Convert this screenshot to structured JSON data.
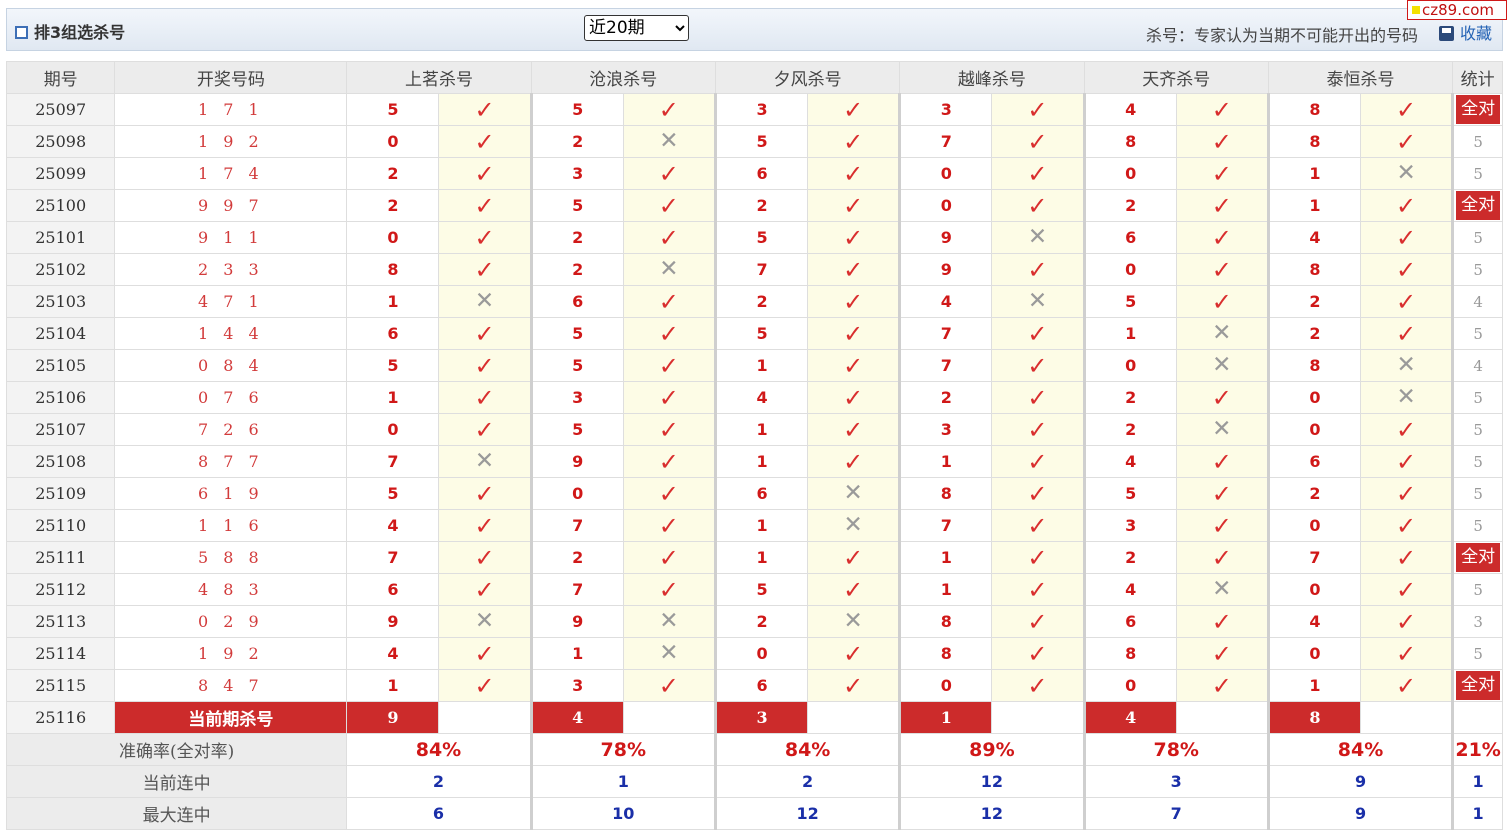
{
  "watermark": "cz89.com",
  "header": {
    "title": "排3组选杀号",
    "period_select": "近20期",
    "hint": "杀号：专家认为当期不可能开出的号码",
    "favorite": "收藏"
  },
  "columns": {
    "period": "期号",
    "draw": "开奖号码",
    "experts": [
      "上茗杀号",
      "沧浪杀号",
      "夕风杀号",
      "越峰杀号",
      "天齐杀号",
      "泰恒杀号"
    ],
    "stats": "统计"
  },
  "rows": [
    {
      "period": "25097",
      "draw": "1 7 1",
      "kills": [
        [
          "5",
          "✓"
        ],
        [
          "5",
          "✓"
        ],
        [
          "3",
          "✓"
        ],
        [
          "3",
          "✓"
        ],
        [
          "4",
          "✓"
        ],
        [
          "8",
          "✓"
        ]
      ],
      "stat": "全对"
    },
    {
      "period": "25098",
      "draw": "1 9 2",
      "kills": [
        [
          "0",
          "✓"
        ],
        [
          "2",
          "✕"
        ],
        [
          "5",
          "✓"
        ],
        [
          "7",
          "✓"
        ],
        [
          "8",
          "✓"
        ],
        [
          "8",
          "✓"
        ]
      ],
      "stat": "5"
    },
    {
      "period": "25099",
      "draw": "1 7 4",
      "kills": [
        [
          "2",
          "✓"
        ],
        [
          "3",
          "✓"
        ],
        [
          "6",
          "✓"
        ],
        [
          "0",
          "✓"
        ],
        [
          "0",
          "✓"
        ],
        [
          "1",
          "✕"
        ]
      ],
      "stat": "5"
    },
    {
      "period": "25100",
      "draw": "9 9 7",
      "kills": [
        [
          "2",
          "✓"
        ],
        [
          "5",
          "✓"
        ],
        [
          "2",
          "✓"
        ],
        [
          "0",
          "✓"
        ],
        [
          "2",
          "✓"
        ],
        [
          "1",
          "✓"
        ]
      ],
      "stat": "全对"
    },
    {
      "period": "25101",
      "draw": "9 1 1",
      "kills": [
        [
          "0",
          "✓"
        ],
        [
          "2",
          "✓"
        ],
        [
          "5",
          "✓"
        ],
        [
          "9",
          "✕"
        ],
        [
          "6",
          "✓"
        ],
        [
          "4",
          "✓"
        ]
      ],
      "stat": "5"
    },
    {
      "period": "25102",
      "draw": "2 3 3",
      "kills": [
        [
          "8",
          "✓"
        ],
        [
          "2",
          "✕"
        ],
        [
          "7",
          "✓"
        ],
        [
          "9",
          "✓"
        ],
        [
          "0",
          "✓"
        ],
        [
          "8",
          "✓"
        ]
      ],
      "stat": "5"
    },
    {
      "period": "25103",
      "draw": "4 7 1",
      "kills": [
        [
          "1",
          "✕"
        ],
        [
          "6",
          "✓"
        ],
        [
          "2",
          "✓"
        ],
        [
          "4",
          "✕"
        ],
        [
          "5",
          "✓"
        ],
        [
          "2",
          "✓"
        ]
      ],
      "stat": "4"
    },
    {
      "period": "25104",
      "draw": "1 4 4",
      "kills": [
        [
          "6",
          "✓"
        ],
        [
          "5",
          "✓"
        ],
        [
          "5",
          "✓"
        ],
        [
          "7",
          "✓"
        ],
        [
          "1",
          "✕"
        ],
        [
          "2",
          "✓"
        ]
      ],
      "stat": "5"
    },
    {
      "period": "25105",
      "draw": "0 8 4",
      "kills": [
        [
          "5",
          "✓"
        ],
        [
          "5",
          "✓"
        ],
        [
          "1",
          "✓"
        ],
        [
          "7",
          "✓"
        ],
        [
          "0",
          "✕"
        ],
        [
          "8",
          "✕"
        ]
      ],
      "stat": "4"
    },
    {
      "period": "25106",
      "draw": "0 7 6",
      "kills": [
        [
          "1",
          "✓"
        ],
        [
          "3",
          "✓"
        ],
        [
          "4",
          "✓"
        ],
        [
          "2",
          "✓"
        ],
        [
          "2",
          "✓"
        ],
        [
          "0",
          "✕"
        ]
      ],
      "stat": "5"
    },
    {
      "period": "25107",
      "draw": "7 2 6",
      "kills": [
        [
          "0",
          "✓"
        ],
        [
          "5",
          "✓"
        ],
        [
          "1",
          "✓"
        ],
        [
          "3",
          "✓"
        ],
        [
          "2",
          "✕"
        ],
        [
          "0",
          "✓"
        ]
      ],
      "stat": "5"
    },
    {
      "period": "25108",
      "draw": "8 7 7",
      "kills": [
        [
          "7",
          "✕"
        ],
        [
          "9",
          "✓"
        ],
        [
          "1",
          "✓"
        ],
        [
          "1",
          "✓"
        ],
        [
          "4",
          "✓"
        ],
        [
          "6",
          "✓"
        ]
      ],
      "stat": "5"
    },
    {
      "period": "25109",
      "draw": "6 1 9",
      "kills": [
        [
          "5",
          "✓"
        ],
        [
          "0",
          "✓"
        ],
        [
          "6",
          "✕"
        ],
        [
          "8",
          "✓"
        ],
        [
          "5",
          "✓"
        ],
        [
          "2",
          "✓"
        ]
      ],
      "stat": "5"
    },
    {
      "period": "25110",
      "draw": "1 1 6",
      "kills": [
        [
          "4",
          "✓"
        ],
        [
          "7",
          "✓"
        ],
        [
          "1",
          "✕"
        ],
        [
          "7",
          "✓"
        ],
        [
          "3",
          "✓"
        ],
        [
          "0",
          "✓"
        ]
      ],
      "stat": "5"
    },
    {
      "period": "25111",
      "draw": "5 8 8",
      "kills": [
        [
          "7",
          "✓"
        ],
        [
          "2",
          "✓"
        ],
        [
          "1",
          "✓"
        ],
        [
          "1",
          "✓"
        ],
        [
          "2",
          "✓"
        ],
        [
          "7",
          "✓"
        ]
      ],
      "stat": "全对"
    },
    {
      "period": "25112",
      "draw": "4 8 3",
      "kills": [
        [
          "6",
          "✓"
        ],
        [
          "7",
          "✓"
        ],
        [
          "5",
          "✓"
        ],
        [
          "1",
          "✓"
        ],
        [
          "4",
          "✕"
        ],
        [
          "0",
          "✓"
        ]
      ],
      "stat": "5"
    },
    {
      "period": "25113",
      "draw": "0 2 9",
      "kills": [
        [
          "9",
          "✕"
        ],
        [
          "9",
          "✕"
        ],
        [
          "2",
          "✕"
        ],
        [
          "8",
          "✓"
        ],
        [
          "6",
          "✓"
        ],
        [
          "4",
          "✓"
        ]
      ],
      "stat": "3"
    },
    {
      "period": "25114",
      "draw": "1 9 2",
      "kills": [
        [
          "4",
          "✓"
        ],
        [
          "1",
          "✕"
        ],
        [
          "0",
          "✓"
        ],
        [
          "8",
          "✓"
        ],
        [
          "8",
          "✓"
        ],
        [
          "0",
          "✓"
        ]
      ],
      "stat": "5"
    },
    {
      "period": "25115",
      "draw": "8 4 7",
      "kills": [
        [
          "1",
          "✓"
        ],
        [
          "3",
          "✓"
        ],
        [
          "6",
          "✓"
        ],
        [
          "0",
          "✓"
        ],
        [
          "0",
          "✓"
        ],
        [
          "1",
          "✓"
        ]
      ],
      "stat": "全对"
    }
  ],
  "current": {
    "period": "25116",
    "label": "当前期杀号",
    "kills": [
      "9",
      "4",
      "3",
      "1",
      "4",
      "8"
    ]
  },
  "summary": {
    "accuracy": {
      "label": "准确率(全对率)",
      "values": [
        "84%",
        "78%",
        "84%",
        "89%",
        "78%",
        "84%"
      ],
      "stat": "21%"
    },
    "current_streak": {
      "label": "当前连中",
      "values": [
        "2",
        "1",
        "2",
        "12",
        "3",
        "9"
      ],
      "stat": "1"
    },
    "max_streak": {
      "label": "最大连中",
      "values": [
        "6",
        "10",
        "12",
        "12",
        "7",
        "9"
      ],
      "stat": "1"
    }
  }
}
